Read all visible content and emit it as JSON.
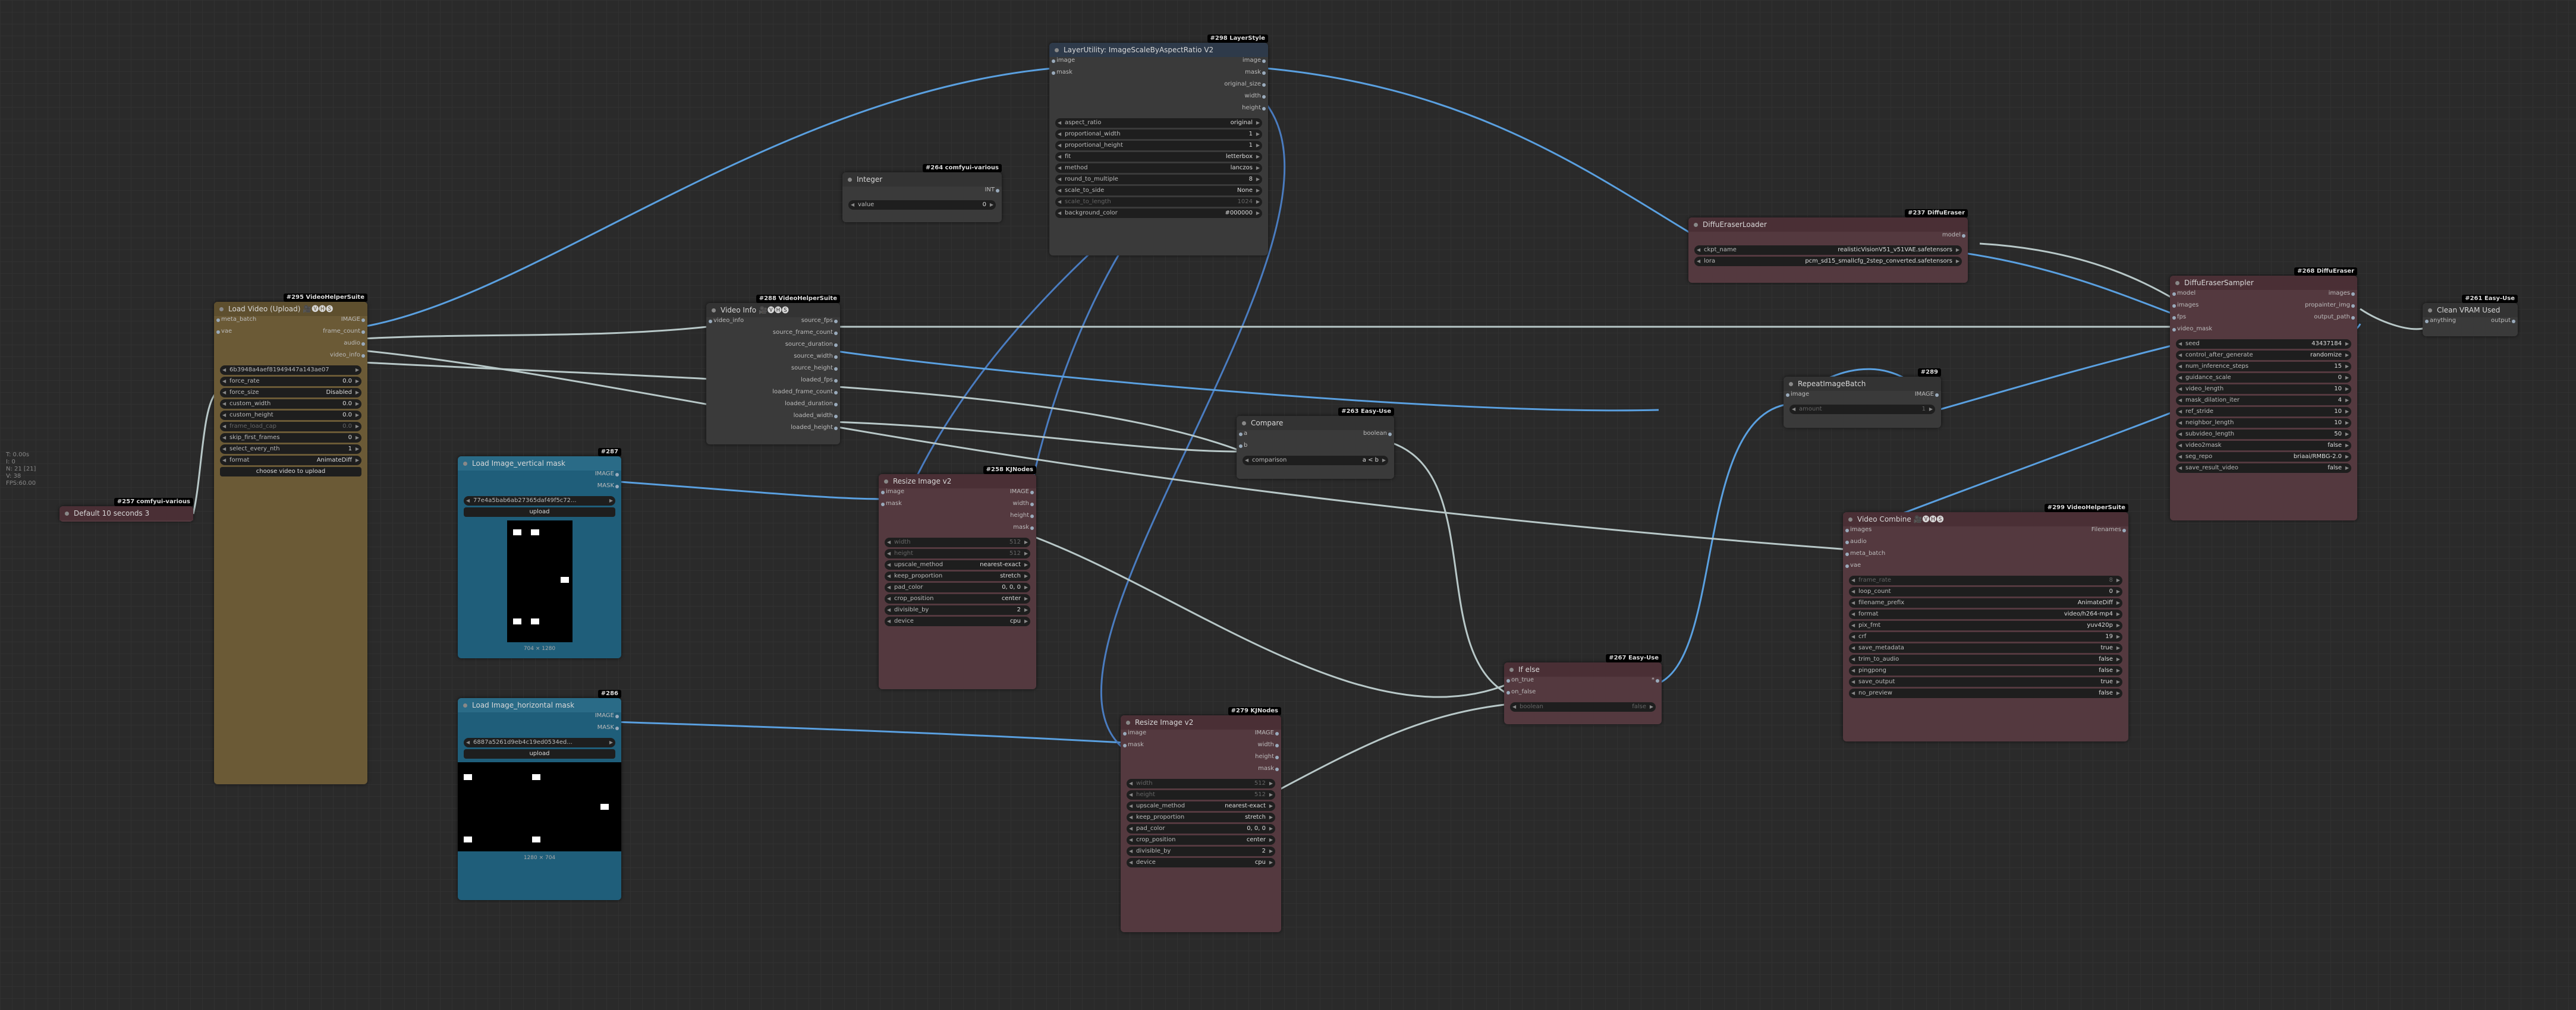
{
  "nodes": {
    "default_text": {
      "badge": "#257 comfyui-various",
      "title": "Default 10 seconds 3"
    },
    "load_video": {
      "badge": "#295 VideoHelperSuite",
      "title": "Load Video (Upload) 🎥🅥🅗🅢",
      "inputs": [
        "meta_batch",
        "vae"
      ],
      "outputs": [
        "IMAGE",
        "frame_count",
        "audio",
        "video_info"
      ],
      "file": "6b3948a4aef81949447a143ae07",
      "widgets": [
        {
          "k": "force_rate",
          "v": "0.0"
        },
        {
          "k": "force_size",
          "v": "Disabled"
        },
        {
          "k": "custom_width",
          "v": "0.0"
        },
        {
          "k": "custom_height",
          "v": "0.0"
        },
        {
          "k": "frame_load_cap",
          "v": "0.0"
        },
        {
          "k": "skip_first_frames",
          "v": "0"
        },
        {
          "k": "select_every_nth",
          "v": "1"
        },
        {
          "k": "format",
          "v": "AnimateDiff"
        }
      ],
      "button": "choose video to upload"
    },
    "load_vmask": {
      "badge": "#287",
      "title": "Load Image_vertical mask",
      "outputs": [
        "IMAGE",
        "MASK"
      ],
      "file": "77e4a5bab6ab27365daf49f5c72...",
      "upload": "upload",
      "caption": "704 × 1280"
    },
    "load_hmask": {
      "badge": "#286",
      "title": "Load Image_horizontal mask",
      "outputs": [
        "IMAGE",
        "MASK"
      ],
      "file": "6887a5261d9eb4c19ed0534ed...",
      "upload": "upload",
      "caption": "1280 × 704"
    },
    "integer": {
      "badge": "#264 comfyui-various",
      "title": "Integer",
      "outputs": [
        "INT"
      ],
      "widgets": [
        {
          "k": "value",
          "v": "0"
        }
      ]
    },
    "video_info": {
      "badge": "#288 VideoHelperSuite",
      "title": "Video Info 🎥🅥🅗🅢",
      "inputs": [
        "video_info"
      ],
      "outputs": [
        "source_fps",
        "source_frame_count",
        "source_duration",
        "source_width",
        "source_height",
        "loaded_fps",
        "loaded_frame_count",
        "loaded_duration",
        "loaded_width",
        "loaded_height"
      ]
    },
    "layerutility": {
      "badge": "#298 LayerStyle",
      "title": "LayerUtility: ImageScaleByAspectRatio V2",
      "inputs": [
        "image",
        "mask"
      ],
      "outputs": [
        "image",
        "mask",
        "original_size",
        "width",
        "height"
      ],
      "widgets": [
        {
          "k": "aspect_ratio",
          "v": "original"
        },
        {
          "k": "proportional_width",
          "v": "1"
        },
        {
          "k": "proportional_height",
          "v": "1"
        },
        {
          "k": "fit",
          "v": "letterbox"
        },
        {
          "k": "method",
          "v": "lanczos"
        },
        {
          "k": "round_to_multiple",
          "v": "8"
        },
        {
          "k": "scale_to_side",
          "v": "None"
        },
        {
          "k": "scale_to_length",
          "v": "1024"
        },
        {
          "k": "background_color",
          "v": "#000000"
        }
      ]
    },
    "resize1": {
      "badge": "#258 KJNodes",
      "title": "Resize Image v2",
      "inputs": [
        "image",
        "mask"
      ],
      "outputs": [
        "IMAGE",
        "width",
        "height",
        "mask"
      ],
      "widgets": [
        {
          "k": "width",
          "v": "512"
        },
        {
          "k": "height",
          "v": "512"
        },
        {
          "k": "upscale_method",
          "v": "nearest-exact"
        },
        {
          "k": "keep_proportion",
          "v": "stretch"
        },
        {
          "k": "pad_color",
          "v": "0, 0, 0"
        },
        {
          "k": "crop_position",
          "v": "center"
        },
        {
          "k": "divisible_by",
          "v": "2"
        },
        {
          "k": "device",
          "v": "cpu"
        }
      ]
    },
    "resize2": {
      "badge": "#279 KJNodes",
      "title": "Resize Image v2",
      "inputs": [
        "image",
        "mask"
      ],
      "outputs": [
        "IMAGE",
        "width",
        "height",
        "mask"
      ],
      "widgets": [
        {
          "k": "width",
          "v": "512"
        },
        {
          "k": "height",
          "v": "512"
        },
        {
          "k": "upscale_method",
          "v": "nearest-exact"
        },
        {
          "k": "keep_proportion",
          "v": "stretch"
        },
        {
          "k": "pad_color",
          "v": "0, 0, 0"
        },
        {
          "k": "crop_position",
          "v": "center"
        },
        {
          "k": "divisible_by",
          "v": "2"
        },
        {
          "k": "device",
          "v": "cpu"
        }
      ]
    },
    "compare": {
      "badge": "#263 Easy-Use",
      "title": "Compare",
      "inputs": [
        "a",
        "b"
      ],
      "outputs": [
        "boolean"
      ],
      "widgets": [
        {
          "k": "comparison",
          "v": "a < b"
        }
      ]
    },
    "ifelse": {
      "badge": "#267 Easy-Use",
      "title": "If else",
      "inputs": [
        "on_true",
        "on_false",
        "boolean"
      ],
      "outputs": [
        "*"
      ],
      "widgets": [
        {
          "k": "boolean",
          "v": "false"
        }
      ]
    },
    "repeat": {
      "badge": "#289",
      "title": "RepeatImageBatch",
      "inputs": [
        "image"
      ],
      "outputs": [
        "IMAGE"
      ],
      "widgets": [
        {
          "k": "amount",
          "v": "1"
        }
      ]
    },
    "loader": {
      "badge": "#237 DiffuEraser",
      "title": "DiffuEraserLoader",
      "outputs": [
        "model"
      ],
      "widgets": [
        {
          "k": "ckpt_name",
          "v": "realisticVisionV51_v51VAE.safetensors"
        },
        {
          "k": "lora",
          "v": "pcm_sd15_smallcfg_2step_converted.safetensors"
        }
      ]
    },
    "sampler": {
      "badge": "#268 DiffuEraser",
      "title": "DiffuEraserSampler",
      "inputs": [
        "model",
        "images",
        "fps",
        "video_mask"
      ],
      "outputs": [
        "images",
        "propainter_img",
        "output_path"
      ],
      "widgets": [
        {
          "k": "seed",
          "v": "43437184"
        },
        {
          "k": "control_after_generate",
          "v": "randomize"
        },
        {
          "k": "num_inference_steps",
          "v": "15"
        },
        {
          "k": "guidance_scale",
          "v": "0"
        },
        {
          "k": "video_length",
          "v": "10"
        },
        {
          "k": "mask_dilation_iter",
          "v": "4"
        },
        {
          "k": "ref_stride",
          "v": "10"
        },
        {
          "k": "neighbor_length",
          "v": "10"
        },
        {
          "k": "subvideo_length",
          "v": "50"
        },
        {
          "k": "video2mask",
          "v": "false"
        },
        {
          "k": "seg_repo",
          "v": "briaai/RMBG-2.0"
        },
        {
          "k": "save_result_video",
          "v": "false"
        }
      ]
    },
    "clean": {
      "badge": "#261 Easy-Use",
      "title": "Clean VRAM Used",
      "inputs": [
        "anything"
      ],
      "outputs": [
        "output"
      ]
    },
    "combine": {
      "badge": "#299 VideoHelperSuite",
      "title": "Video Combine 🎥🅥🅗🅢",
      "inputs": [
        "images",
        "audio",
        "meta_batch",
        "vae"
      ],
      "outputs": [
        "Filenames"
      ],
      "widgets": [
        {
          "k": "frame_rate",
          "v": "8"
        },
        {
          "k": "loop_count",
          "v": "0"
        },
        {
          "k": "filename_prefix",
          "v": "AnimateDiff"
        },
        {
          "k": "format",
          "v": "video/h264-mp4"
        },
        {
          "k": "pix_fmt",
          "v": "yuv420p"
        },
        {
          "k": "crf",
          "v": "19"
        },
        {
          "k": "save_metadata",
          "v": "true"
        },
        {
          "k": "trim_to_audio",
          "v": "false"
        },
        {
          "k": "pingpong",
          "v": "false"
        },
        {
          "k": "save_output",
          "v": "true"
        },
        {
          "k": "no_preview",
          "v": "false"
        }
      ]
    }
  },
  "stats": [
    "T: 0.00s",
    "I: 0",
    "N: 21 [21]",
    "V: 38",
    "FPS:60.00"
  ]
}
